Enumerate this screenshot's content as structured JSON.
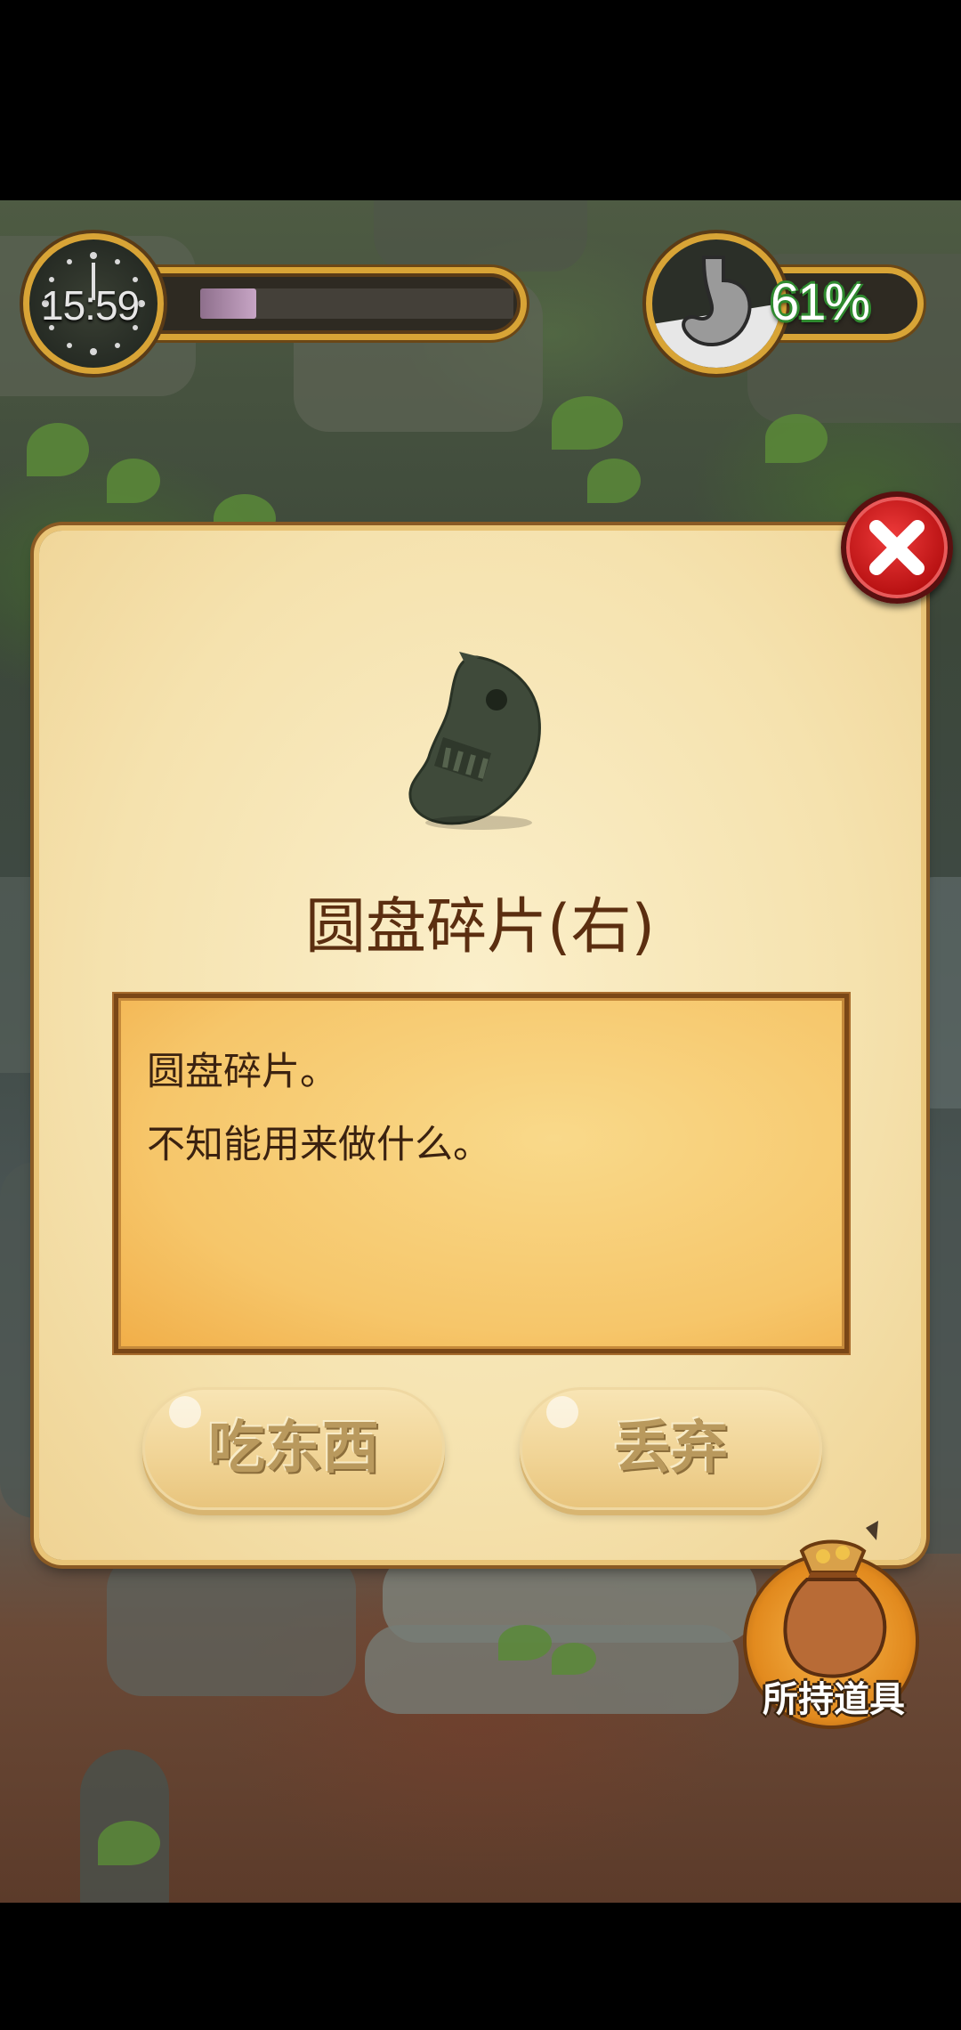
{
  "hud": {
    "clock": {
      "time": "15:59",
      "progress": 0.18
    },
    "stomach": {
      "percent": "61%"
    }
  },
  "item_popup": {
    "icon": "stone-disc-fragment-icon",
    "title": "圆盘碎片(右)",
    "description": [
      "圆盘碎片。",
      "不知能用来做什么。"
    ],
    "buttons": {
      "eat": "吃东西",
      "discard": "丢弃"
    },
    "close_icon": "close-icon"
  },
  "inventory": {
    "label": "所持道具",
    "icon": "item-bag-icon"
  },
  "colors": {
    "panel": "#f5e2ae",
    "title": "#5b2e10",
    "close_button": "#d21c1d",
    "stomach_text_outline": "#2f8a2f",
    "clock_progress": "#b995b7"
  }
}
